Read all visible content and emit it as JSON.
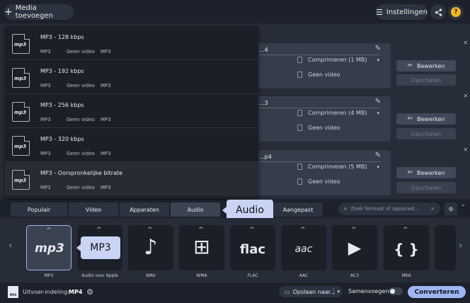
{
  "toolbar": {
    "add_media_label": "Media toevoegen",
    "settings_label": "Instellingen",
    "share_icon": "share-icon",
    "help_label": "?"
  },
  "files": [
    {
      "name": "...4",
      "compress": "Comprimeren (1 MB)",
      "video": "Geen video",
      "edit": "Bewerken",
      "upscale": "Opschalen"
    },
    {
      "name": "...3",
      "compress": "Comprimeren (4 MB)",
      "video": "Geen video",
      "edit": "Bewerken",
      "upscale": "Opschalen"
    },
    {
      "name": "...p4",
      "compress": "Comprimeren (5 MB)",
      "video": "Geen video",
      "edit": "Bewerken",
      "upscale": "Opschalen"
    }
  ],
  "dropdown": {
    "items": [
      {
        "title": "MP3 - 128 kbps",
        "meta": [
          "MP3",
          "Geen video",
          "MP3"
        ],
        "icon_text": "mp3"
      },
      {
        "title": "MP3 - 192 kbps",
        "meta": [
          "MP3",
          "Geen video",
          "MP3"
        ],
        "icon_text": "mp3"
      },
      {
        "title": "MP3 - 256 kbps",
        "meta": [
          "MP3",
          "Geen video",
          "MP3"
        ],
        "icon_text": "mp3"
      },
      {
        "title": "MP3 - 320 kbps",
        "meta": [
          "MP3",
          "Geen video",
          "MP3"
        ],
        "icon_text": "mp3"
      },
      {
        "title": "MP3 - Oorspronkelijke bitrate",
        "meta": [
          "MP3",
          "Geen video",
          "MP3"
        ],
        "icon_text": "mp3"
      }
    ]
  },
  "tabs": [
    {
      "label": "Populair"
    },
    {
      "label": "Video"
    },
    {
      "label": "Apparaten"
    },
    {
      "label": "Audio",
      "active": true
    },
    {
      "label": "Aangepast"
    }
  ],
  "tooltips": {
    "audio": "Audio",
    "mp3": "MP3"
  },
  "search": {
    "placeholder": "Zoek formaat of apparaat...",
    "clear": "×"
  },
  "formats": [
    {
      "label": "MP3",
      "glyph": "mp3",
      "selected": true
    },
    {
      "label": "Audio voor Apple",
      "glyph": ""
    },
    {
      "label": "WAV",
      "glyph": "♪"
    },
    {
      "label": "WMA",
      "glyph": "⊞"
    },
    {
      "label": "FLAC",
      "glyph": "flac"
    },
    {
      "label": "AAC",
      "glyph": "aac"
    },
    {
      "label": "AC3",
      "glyph": "▶"
    },
    {
      "label": "MKA",
      "glyph": "{ }"
    }
  ],
  "bottom": {
    "output_label": "Uitvoer-indeling:",
    "output_value": "MP4",
    "output_icon_text": "MP4",
    "save_label": "Opslaan naar...",
    "merge_label": "Samenvoegen:",
    "convert_label": "Converteren"
  },
  "colors": {
    "accent": "#9eb6f0",
    "tooltip": "#c9d4f4",
    "background": "#1f2430"
  }
}
